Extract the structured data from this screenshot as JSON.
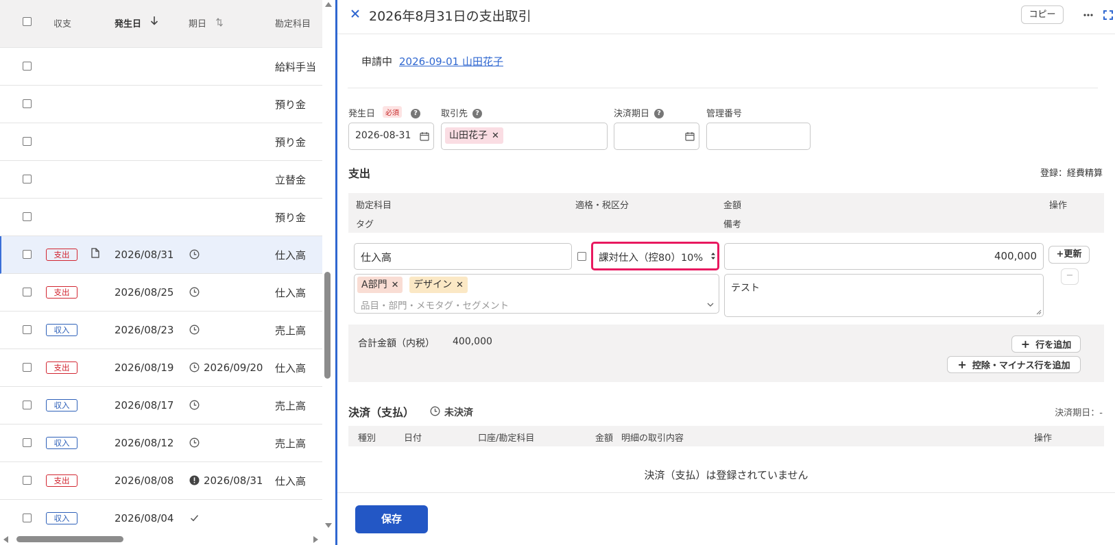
{
  "list": {
    "headers": {
      "type": "収支",
      "date": "発生日",
      "due": "期日",
      "account": "勘定科目"
    },
    "rows": [
      {
        "account": "給料手当"
      },
      {
        "account": "預り金"
      },
      {
        "account": "預り金"
      },
      {
        "account": "立替金"
      },
      {
        "account": "預り金"
      },
      {
        "type": "支出",
        "date": "2026/08/31",
        "due": "",
        "account": "仕入高"
      },
      {
        "type": "支出",
        "date": "2026/08/25",
        "due": "",
        "account": "仕入高"
      },
      {
        "type": "収入",
        "date": "2026/08/23",
        "due": "",
        "account": "売上高"
      },
      {
        "type": "支出",
        "date": "2026/08/19",
        "due": "2026/09/20",
        "account": "仕入高"
      },
      {
        "type": "収入",
        "date": "2026/08/17",
        "due": "",
        "account": "売上高"
      },
      {
        "type": "収入",
        "date": "2026/08/12",
        "due": "",
        "account": "売上高"
      },
      {
        "type": "支出",
        "date": "2026/08/08",
        "due": "2026/08/31",
        "account": "仕入高"
      },
      {
        "type": "収入",
        "date": "2026/08/04",
        "due": "",
        "account": ""
      }
    ]
  },
  "panel": {
    "title": "2026年8月31日の支出取引",
    "copy_label": "コピー",
    "status_label": "申請中",
    "status_link": "2026-09-01 山田花子",
    "fields": {
      "date_label": "発生日",
      "required_badge": "必須",
      "date_value": "2026-08-31",
      "partner_label": "取引先",
      "partner_chip": "山田花子",
      "due_label": "決済期日",
      "mgmt_label": "管理番号"
    },
    "expense": {
      "section_title": "支出",
      "registered": "登録：経費精算",
      "col_account": "勘定科目",
      "col_tax": "適格・税区分",
      "col_amount": "金額",
      "col_ops": "操作",
      "col_tag": "タグ",
      "col_memo": "備考",
      "account_value": "仕入高",
      "tax_value": "課対仕入（控80）10%",
      "amount_value": "400,000",
      "update_btn": "+更新",
      "tags": [
        "A部門",
        "デザイン"
      ],
      "tag_placeholder": "品目・部門・メモタグ・セグメント",
      "memo_value": "テスト",
      "total_label": "合計金額（内税）",
      "total_value": "400,000",
      "add_row_btn": "行を追加",
      "add_deduct_btn": "控除・マイナス行を追加"
    },
    "settlement": {
      "title": "決済（支払）",
      "status": "未決済",
      "due_text": "決済期日：-",
      "col_kind": "種別",
      "col_date": "日付",
      "col_account": "口座/勘定科目",
      "col_amount": "金額",
      "col_detail": "明細の取引内容",
      "col_ops": "操作",
      "empty_text": "決済（支払）は登録されていません"
    },
    "save_label": "保存"
  },
  "colors": {
    "accent": "#2f67d0",
    "expense_red": "#d1242f",
    "income_blue": "#2c5fb8",
    "highlight": "#e8185f",
    "save_button": "#2357c5"
  }
}
